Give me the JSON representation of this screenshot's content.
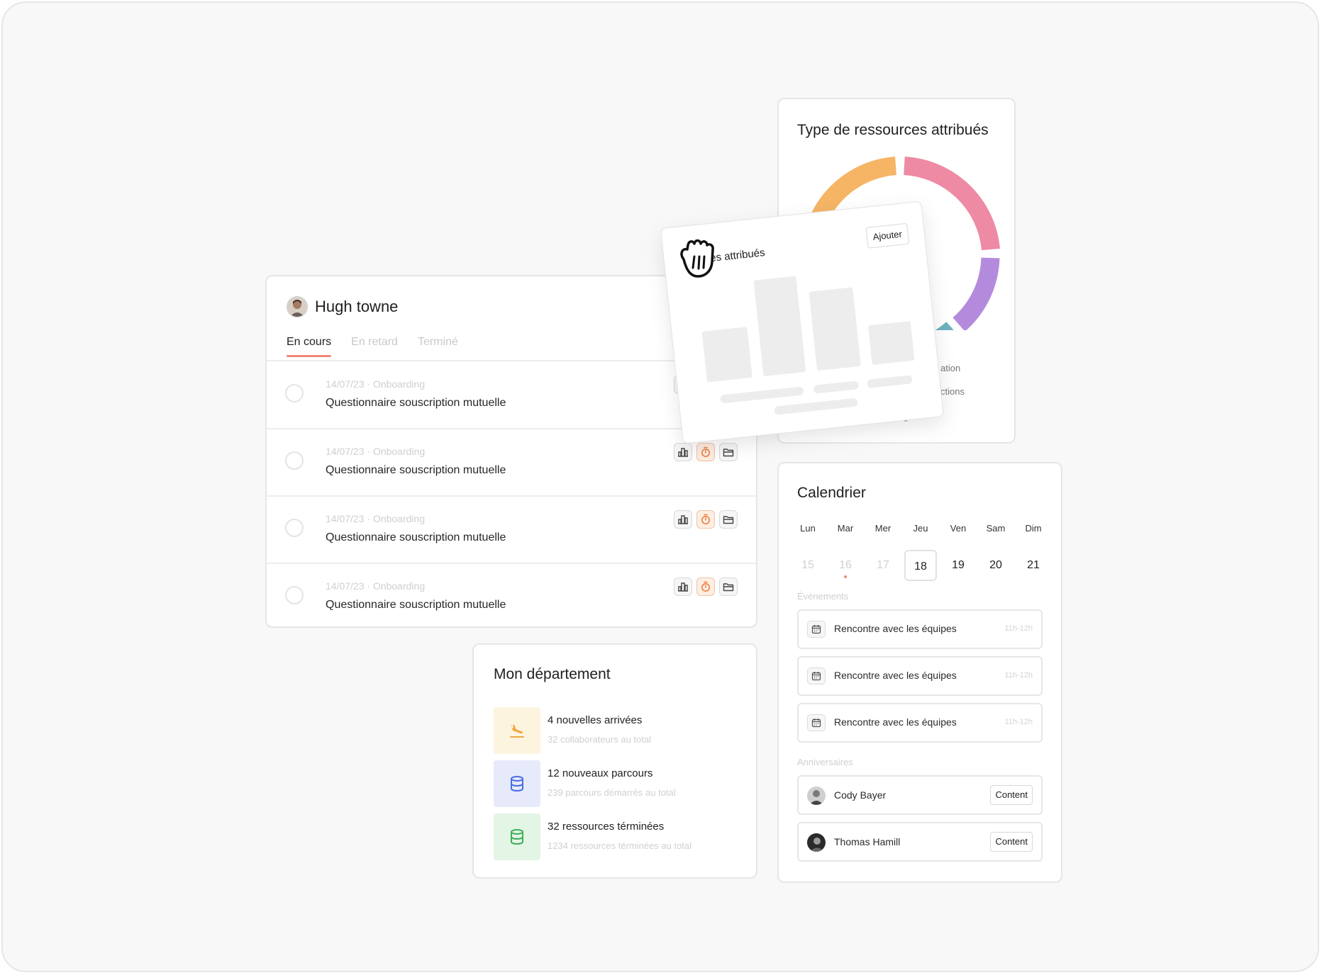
{
  "tasks_panel": {
    "user_name": "Hugh towne",
    "tabs": [
      {
        "label": "En cours",
        "active": true
      },
      {
        "label": "En retard",
        "active": false
      },
      {
        "label": "Terminé",
        "active": false
      }
    ],
    "items": [
      {
        "meta": "14/07/23 · Onboarding",
        "title": "Questionnaire souscription mutuelle"
      },
      {
        "meta": "14/07/23 · Onboarding",
        "title": "Questionnaire souscription mutuelle"
      },
      {
        "meta": "14/07/23 · Onboarding",
        "title": "Questionnaire souscription mutuelle"
      },
      {
        "meta": "14/07/23 · Onboarding",
        "title": "Questionnaire souscription mutuelle"
      }
    ]
  },
  "department": {
    "title": "Mon département",
    "items": [
      {
        "main": "4 nouvelles arrivées",
        "sub": "32 collaborateurs au total",
        "icon": "plane-landing-icon",
        "bg": "#fdf4e0",
        "color": "#f0a83e"
      },
      {
        "main": "12 nouveaux parcours",
        "sub": "239 parcours démarrés au total",
        "icon": "database-icon",
        "bg": "#e6eafb",
        "color": "#4a6de5"
      },
      {
        "main": "32 ressources términées",
        "sub": "1234 ressources términées au total",
        "icon": "database-icon",
        "bg": "#e3f5e5",
        "color": "#3fae5a"
      }
    ]
  },
  "resources": {
    "title": "Type de ressources attribués",
    "legend_visible": [
      "ation",
      "ctions",
      "allenges"
    ],
    "segment_colors": [
      "#f5b565",
      "#ee8aa4",
      "#b48bdc",
      "#6fb2be"
    ]
  },
  "floating_card": {
    "title_fragment": "rces attribués",
    "button_label": "Ajouter"
  },
  "calendar": {
    "title": "Calendrier",
    "days": [
      {
        "name": "Lun",
        "num": "15",
        "state": "past"
      },
      {
        "name": "Mar",
        "num": "16",
        "state": "past",
        "dot": true
      },
      {
        "name": "Mer",
        "num": "17",
        "state": "past"
      },
      {
        "name": "Jeu",
        "num": "18",
        "state": "selected"
      },
      {
        "name": "Ven",
        "num": "19",
        "state": "normal"
      },
      {
        "name": "Sam",
        "num": "20",
        "state": "normal"
      },
      {
        "name": "Dim",
        "num": "21",
        "state": "normal"
      }
    ],
    "events_label": "Évènements",
    "events": [
      {
        "title": "Rencontre avec les équipes",
        "time": "11h-12h"
      },
      {
        "title": "Rencontre avec les équipes",
        "time": "11h-12h"
      },
      {
        "title": "Rencontre avec les équipes",
        "time": "11h-12h"
      }
    ],
    "birthdays_label": "Anniversaires",
    "birthdays": [
      {
        "name": "Cody Bayer",
        "button": "Content"
      },
      {
        "name": "Thomas Hamill",
        "button": "Content"
      }
    ]
  },
  "colors": {
    "accent": "#f0867a",
    "timer_orange": "#f07a3a"
  }
}
